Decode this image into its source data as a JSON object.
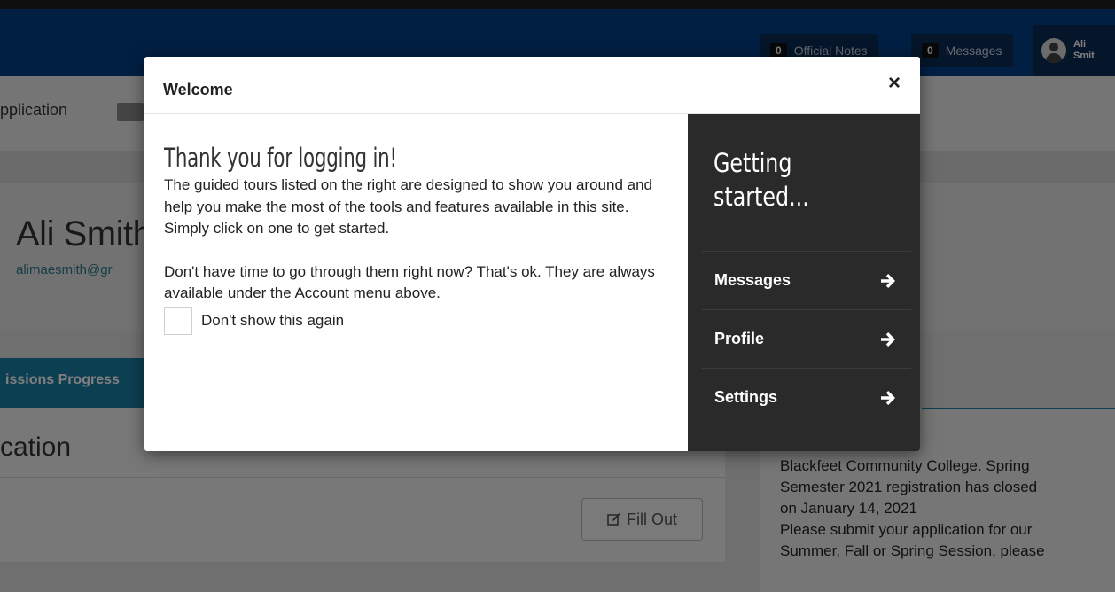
{
  "navbar": {
    "official_notes_count": "0",
    "official_notes_label": "Official Notes",
    "messages_count": "0",
    "messages_label": "Messages",
    "user_first": "Ali",
    "user_last": "Smit"
  },
  "subnav": {
    "link_label": "pplication"
  },
  "profile": {
    "name": "Ali Smith",
    "email": "alimaesmith@gr"
  },
  "tabs": {
    "active_label": "issions Progress"
  },
  "panel": {
    "title": "cation",
    "fill_out_label": "Fill Out"
  },
  "right_panel": {
    "text": "our interest in\nBlackfeet Community College. Spring\nSemester 2021 registration has closed\non January 14, 2021\nPlease submit your application for our\nSummer, Fall or Spring Session, please"
  },
  "modal": {
    "title": "Welcome",
    "close_glyph": "×",
    "heading": "Thank you for logging in!",
    "paragraph1": "The guided tours listed on the right are designed to show you around and help you make the most of the tools and features available in this site. Simply click on one to get started.",
    "paragraph2": "Don't have time to go through them right now? That's ok. They are always available under the Account menu above.",
    "dont_show_label": "Don't show this again",
    "getting_started": "Getting started...",
    "tours": [
      {
        "label": "Messages"
      },
      {
        "label": "Profile"
      },
      {
        "label": "Settings"
      }
    ]
  },
  "colors": {
    "navbar": "#003f86",
    "accent": "#1b7fa5",
    "modal_sidebar": "#2a2a2a"
  }
}
